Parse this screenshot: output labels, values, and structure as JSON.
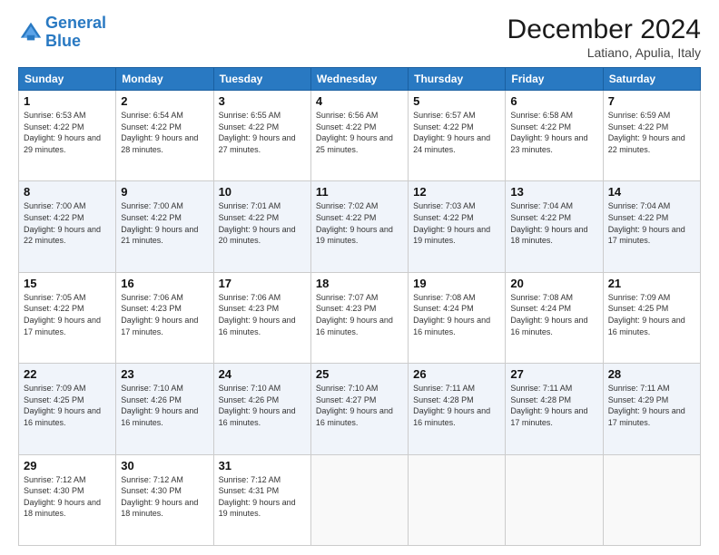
{
  "logo": {
    "line1": "General",
    "line2": "Blue"
  },
  "title": "December 2024",
  "location": "Latiano, Apulia, Italy",
  "days_of_week": [
    "Sunday",
    "Monday",
    "Tuesday",
    "Wednesday",
    "Thursday",
    "Friday",
    "Saturday"
  ],
  "weeks": [
    [
      {
        "day": "1",
        "sunrise": "6:53 AM",
        "sunset": "4:22 PM",
        "daylight": "9 hours and 29 minutes."
      },
      {
        "day": "2",
        "sunrise": "6:54 AM",
        "sunset": "4:22 PM",
        "daylight": "9 hours and 28 minutes."
      },
      {
        "day": "3",
        "sunrise": "6:55 AM",
        "sunset": "4:22 PM",
        "daylight": "9 hours and 27 minutes."
      },
      {
        "day": "4",
        "sunrise": "6:56 AM",
        "sunset": "4:22 PM",
        "daylight": "9 hours and 25 minutes."
      },
      {
        "day": "5",
        "sunrise": "6:57 AM",
        "sunset": "4:22 PM",
        "daylight": "9 hours and 24 minutes."
      },
      {
        "day": "6",
        "sunrise": "6:58 AM",
        "sunset": "4:22 PM",
        "daylight": "9 hours and 23 minutes."
      },
      {
        "day": "7",
        "sunrise": "6:59 AM",
        "sunset": "4:22 PM",
        "daylight": "9 hours and 22 minutes."
      }
    ],
    [
      {
        "day": "8",
        "sunrise": "7:00 AM",
        "sunset": "4:22 PM",
        "daylight": "9 hours and 22 minutes."
      },
      {
        "day": "9",
        "sunrise": "7:00 AM",
        "sunset": "4:22 PM",
        "daylight": "9 hours and 21 minutes."
      },
      {
        "day": "10",
        "sunrise": "7:01 AM",
        "sunset": "4:22 PM",
        "daylight": "9 hours and 20 minutes."
      },
      {
        "day": "11",
        "sunrise": "7:02 AM",
        "sunset": "4:22 PM",
        "daylight": "9 hours and 19 minutes."
      },
      {
        "day": "12",
        "sunrise": "7:03 AM",
        "sunset": "4:22 PM",
        "daylight": "9 hours and 19 minutes."
      },
      {
        "day": "13",
        "sunrise": "7:04 AM",
        "sunset": "4:22 PM",
        "daylight": "9 hours and 18 minutes."
      },
      {
        "day": "14",
        "sunrise": "7:04 AM",
        "sunset": "4:22 PM",
        "daylight": "9 hours and 17 minutes."
      }
    ],
    [
      {
        "day": "15",
        "sunrise": "7:05 AM",
        "sunset": "4:22 PM",
        "daylight": "9 hours and 17 minutes."
      },
      {
        "day": "16",
        "sunrise": "7:06 AM",
        "sunset": "4:23 PM",
        "daylight": "9 hours and 17 minutes."
      },
      {
        "day": "17",
        "sunrise": "7:06 AM",
        "sunset": "4:23 PM",
        "daylight": "9 hours and 16 minutes."
      },
      {
        "day": "18",
        "sunrise": "7:07 AM",
        "sunset": "4:23 PM",
        "daylight": "9 hours and 16 minutes."
      },
      {
        "day": "19",
        "sunrise": "7:08 AM",
        "sunset": "4:24 PM",
        "daylight": "9 hours and 16 minutes."
      },
      {
        "day": "20",
        "sunrise": "7:08 AM",
        "sunset": "4:24 PM",
        "daylight": "9 hours and 16 minutes."
      },
      {
        "day": "21",
        "sunrise": "7:09 AM",
        "sunset": "4:25 PM",
        "daylight": "9 hours and 16 minutes."
      }
    ],
    [
      {
        "day": "22",
        "sunrise": "7:09 AM",
        "sunset": "4:25 PM",
        "daylight": "9 hours and 16 minutes."
      },
      {
        "day": "23",
        "sunrise": "7:10 AM",
        "sunset": "4:26 PM",
        "daylight": "9 hours and 16 minutes."
      },
      {
        "day": "24",
        "sunrise": "7:10 AM",
        "sunset": "4:26 PM",
        "daylight": "9 hours and 16 minutes."
      },
      {
        "day": "25",
        "sunrise": "7:10 AM",
        "sunset": "4:27 PM",
        "daylight": "9 hours and 16 minutes."
      },
      {
        "day": "26",
        "sunrise": "7:11 AM",
        "sunset": "4:28 PM",
        "daylight": "9 hours and 16 minutes."
      },
      {
        "day": "27",
        "sunrise": "7:11 AM",
        "sunset": "4:28 PM",
        "daylight": "9 hours and 17 minutes."
      },
      {
        "day": "28",
        "sunrise": "7:11 AM",
        "sunset": "4:29 PM",
        "daylight": "9 hours and 17 minutes."
      }
    ],
    [
      {
        "day": "29",
        "sunrise": "7:12 AM",
        "sunset": "4:30 PM",
        "daylight": "9 hours and 18 minutes."
      },
      {
        "day": "30",
        "sunrise": "7:12 AM",
        "sunset": "4:30 PM",
        "daylight": "9 hours and 18 minutes."
      },
      {
        "day": "31",
        "sunrise": "7:12 AM",
        "sunset": "4:31 PM",
        "daylight": "9 hours and 19 minutes."
      },
      null,
      null,
      null,
      null
    ]
  ]
}
